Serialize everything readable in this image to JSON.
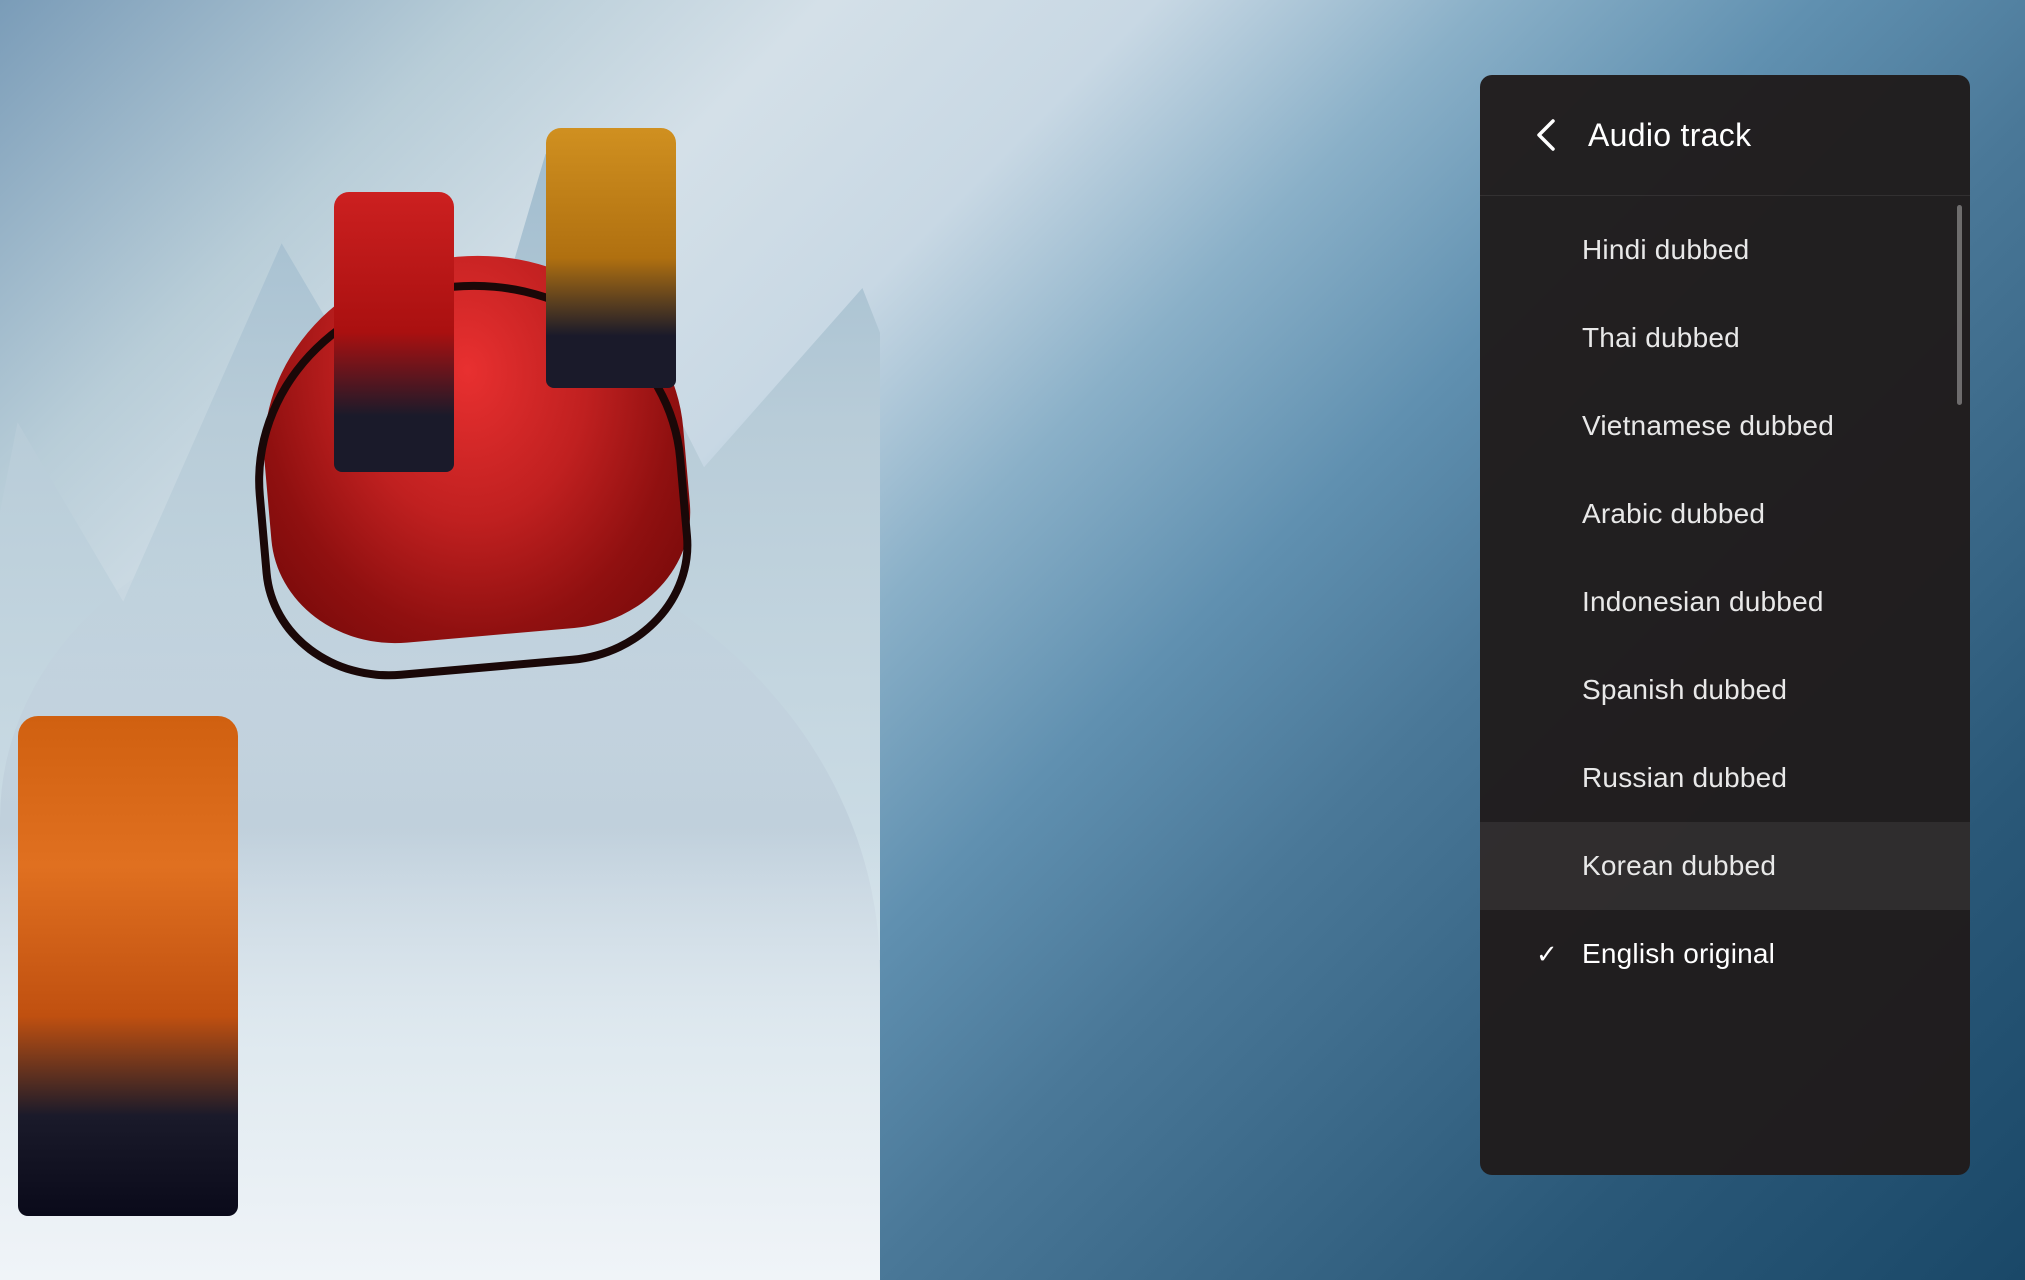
{
  "panel": {
    "title": "Audio track",
    "back_button_label": "‹"
  },
  "tracks": [
    {
      "id": "hindi-dubbed",
      "label": "Hindi dubbed",
      "selected": false,
      "hovered": false
    },
    {
      "id": "thai-dubbed",
      "label": "Thai dubbed",
      "selected": false,
      "hovered": false
    },
    {
      "id": "vietnamese-dubbed",
      "label": "Vietnamese dubbed",
      "selected": false,
      "hovered": false
    },
    {
      "id": "arabic-dubbed",
      "label": "Arabic dubbed",
      "selected": false,
      "hovered": false
    },
    {
      "id": "indonesian-dubbed",
      "label": "Indonesian dubbed",
      "selected": false,
      "hovered": false
    },
    {
      "id": "spanish-dubbed",
      "label": "Spanish dubbed",
      "selected": false,
      "hovered": false
    },
    {
      "id": "russian-dubbed",
      "label": "Russian dubbed",
      "selected": false,
      "hovered": false
    },
    {
      "id": "korean-dubbed",
      "label": "Korean dubbed",
      "selected": false,
      "hovered": true
    },
    {
      "id": "english-original",
      "label": "English original",
      "selected": true,
      "hovered": false
    }
  ],
  "cursor": {
    "visible": true
  }
}
